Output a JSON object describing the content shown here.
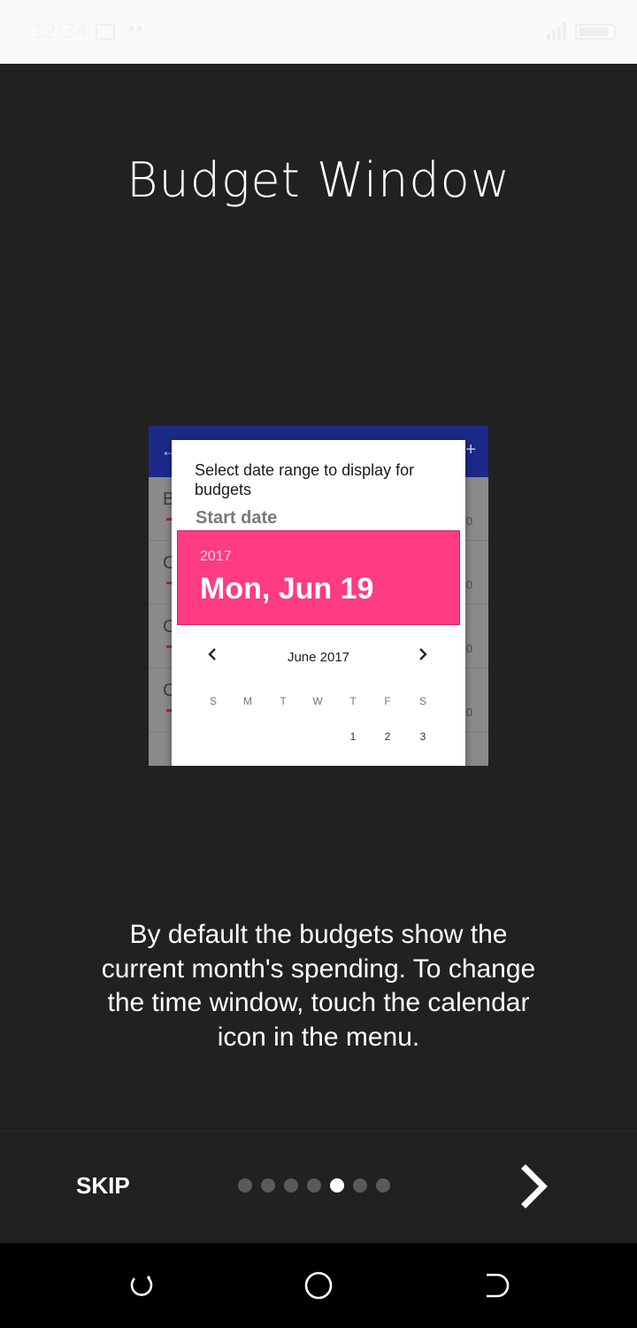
{
  "status_bar": {
    "time": "12:34",
    "dots": "••"
  },
  "page": {
    "title": "Budget Window",
    "description": "By default the budgets show the current month's spending. To change the time window, touch the calendar icon in the menu."
  },
  "preview": {
    "row_letters": [
      "B",
      "C",
      "C",
      "C"
    ],
    "row_value": "0",
    "accent_color": "#ff3b81",
    "appbar_color": "#1b2a8a"
  },
  "dialog": {
    "title": "Select date range to display for budgets",
    "subtitle": "Start date",
    "year": "2017",
    "date": "Mon, Jun 19",
    "month": "June 2017",
    "prev_icon": "chevron-left-icon",
    "next_icon": "chevron-right-icon",
    "weekdays": [
      "S",
      "M",
      "T",
      "W",
      "T",
      "F",
      "S"
    ],
    "first_week": [
      "1",
      "2",
      "3"
    ]
  },
  "bottom": {
    "skip_label": "SKIP",
    "page_count": 7,
    "current_page": 5,
    "next_icon": "chevron-right-icon"
  },
  "nav": {
    "icons": [
      "recent-apps-icon",
      "home-icon",
      "back-icon"
    ]
  }
}
